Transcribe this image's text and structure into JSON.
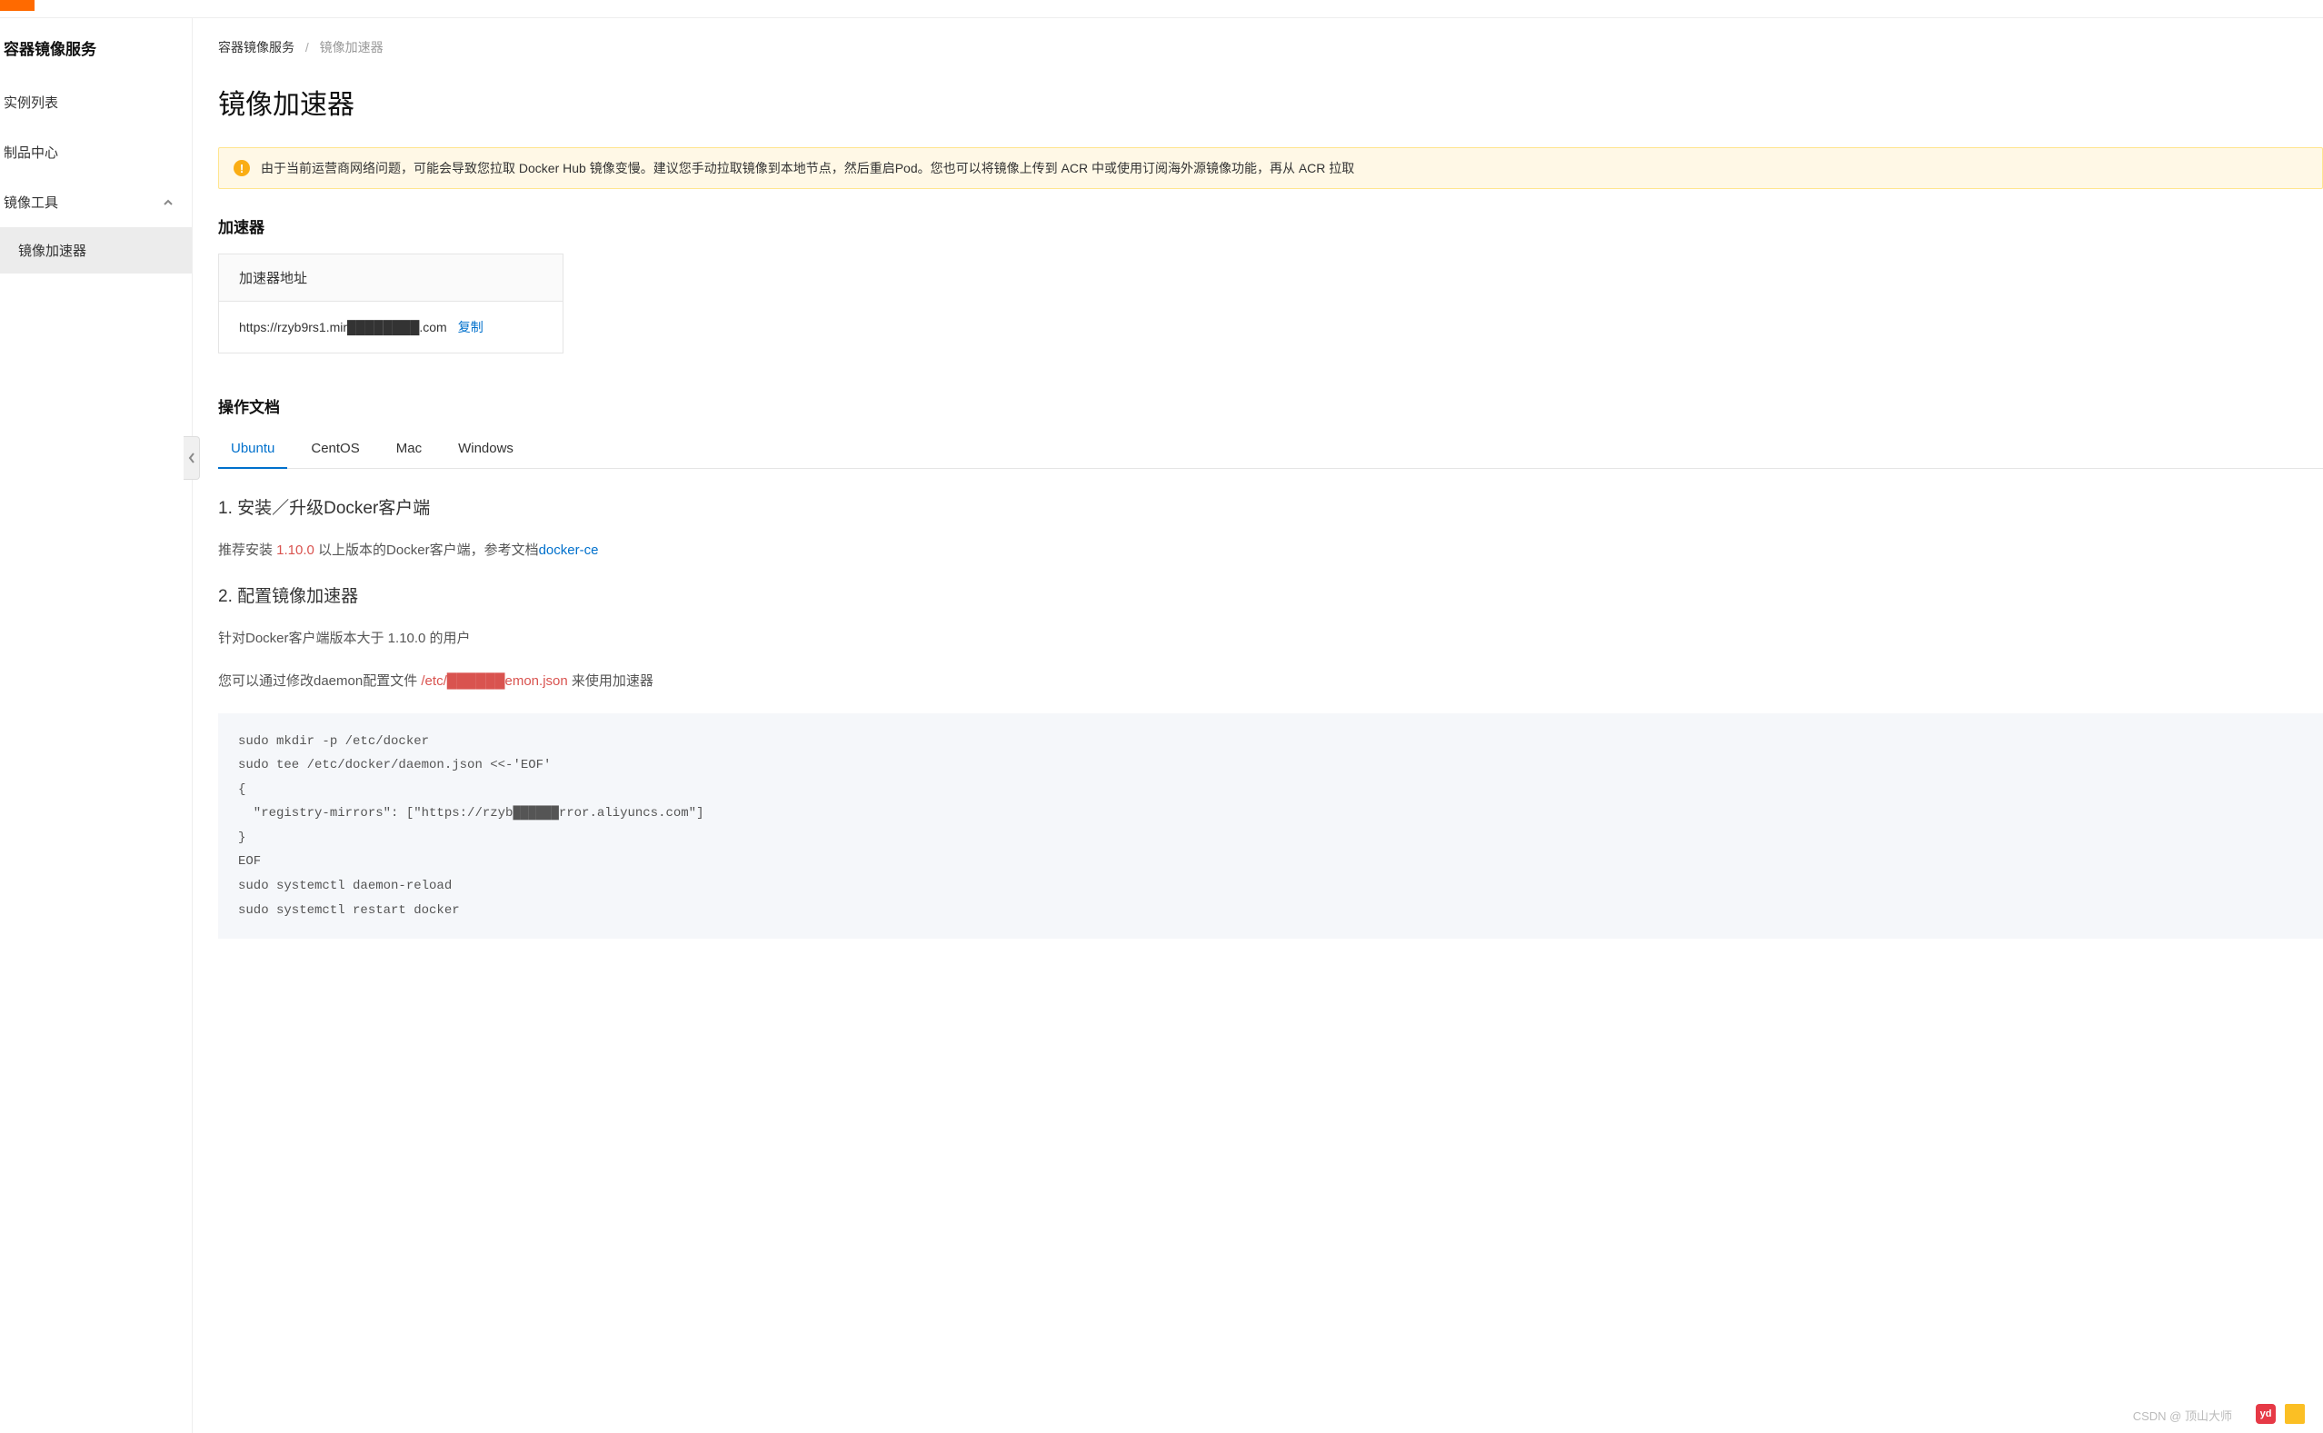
{
  "sidebar": {
    "title": "容器镜像服务",
    "items": [
      {
        "label": "实例列表"
      },
      {
        "label": "制品中心"
      },
      {
        "label": "镜像工具",
        "expandable": true,
        "expanded": true
      }
    ],
    "subitems": [
      {
        "label": "镜像加速器",
        "active": true
      }
    ]
  },
  "breadcrumb": {
    "root": "容器镜像服务",
    "sep": "/",
    "current": "镜像加速器"
  },
  "page_title": "镜像加速器",
  "alert": {
    "icon": "!",
    "text": "由于当前运营商网络问题，可能会导致您拉取 Docker Hub 镜像变慢。建议您手动拉取镜像到本地节点，然后重启Pod。您也可以将镜像上传到 ACR 中或使用订阅海外源镜像功能，再从 ACR 拉取"
  },
  "accelerator": {
    "section_title": "加速器",
    "header": "加速器地址",
    "url": "https://rzyb9rs1.mir████████.com",
    "copy": "复制"
  },
  "docs": {
    "section_title": "操作文档",
    "tabs": [
      {
        "label": "Ubuntu",
        "active": true
      },
      {
        "label": "CentOS"
      },
      {
        "label": "Mac"
      },
      {
        "label": "Windows"
      }
    ],
    "step1": {
      "title": "1. 安装／升级Docker客户端",
      "prefix": "推荐安装 ",
      "version": "1.10.0",
      "mid": " 以上版本的Docker客户端，参考文档",
      "link": "docker-ce"
    },
    "step2": {
      "title": "2. 配置镜像加速器",
      "line1": "针对Docker客户端版本大于 1.10.0 的用户",
      "line2_prefix": "您可以通过修改daemon配置文件 ",
      "path": "/etc/██████emon.json",
      "line2_suffix": " 来使用加速器",
      "code": "sudo mkdir -p /etc/docker\nsudo tee /etc/docker/daemon.json <<-'EOF'\n{\n  \"registry-mirrors\": [\"https://rzyb██████rror.aliyuncs.com\"]\n}\nEOF\nsudo systemctl daemon-reload\nsudo systemctl restart docker"
    }
  },
  "watermark": "CSDN @ 顶山大师",
  "tray": {
    "yd": "yd"
  }
}
